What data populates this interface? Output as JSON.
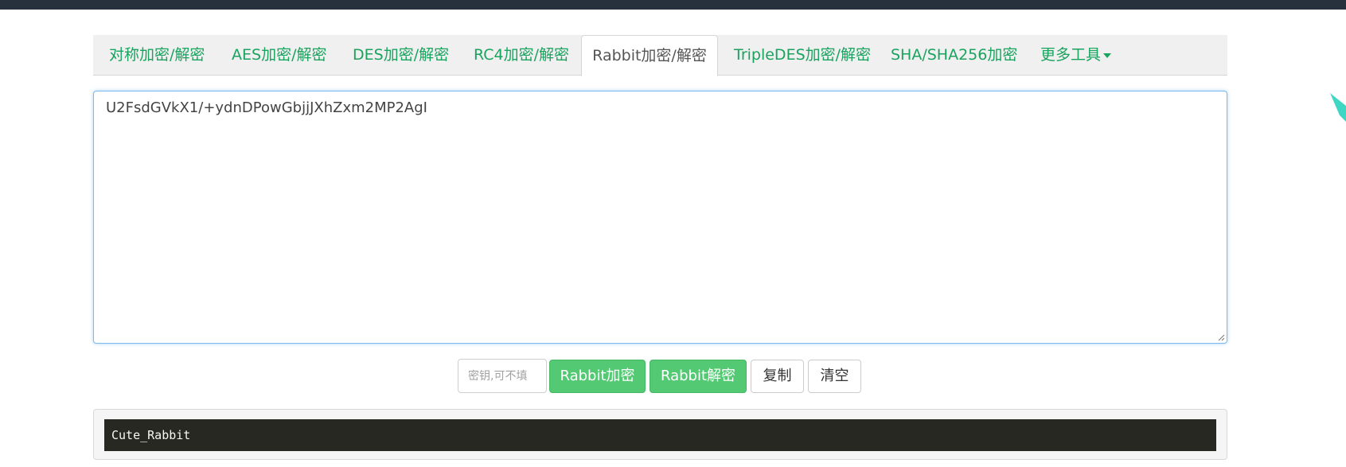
{
  "tabs": [
    {
      "label": "对称加密/解密",
      "active": false
    },
    {
      "label": "AES加密/解密",
      "active": false
    },
    {
      "label": "DES加密/解密",
      "active": false
    },
    {
      "label": "RC4加密/解密",
      "active": false
    },
    {
      "label": "Rabbit加密/解密",
      "active": true
    },
    {
      "label": "TripleDES加密/解密",
      "active": false
    },
    {
      "label": "SHA/SHA256加密",
      "active": false
    },
    {
      "label": "更多工具",
      "active": false,
      "icon": "caret-down-icon"
    }
  ],
  "input": {
    "value": "U2FsdGVkX1/+ydnDPowGbjjJXhZxm2MP2AgI"
  },
  "actions": {
    "key_placeholder": "密钥,可不填",
    "encrypt_label": "Rabbit加密",
    "decrypt_label": "Rabbit解密",
    "copy_label": "复制",
    "clear_label": "清空"
  },
  "result": {
    "text": "Cute_Rabbit"
  },
  "colors": {
    "topbar": "#27313d",
    "accent_green": "#1aa25f",
    "button_green": "#52c972",
    "result_bg": "#272822",
    "deco_teal": "#3fd6c4"
  }
}
